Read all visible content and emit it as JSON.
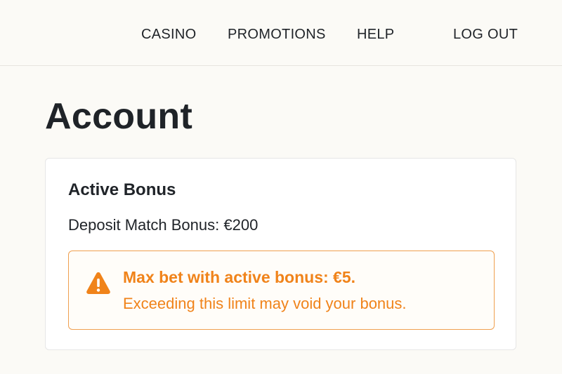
{
  "nav": {
    "casino": "CASINO",
    "promotions": "PROMOTIONS",
    "help": "HELP",
    "logout": "LOG OUT"
  },
  "page": {
    "title": "Account"
  },
  "bonus_card": {
    "title": "Active Bonus",
    "bonus_label": "Deposit Match Bonus:",
    "bonus_amount": "€200",
    "alert": {
      "icon": "warning-triangle-icon",
      "headline": "Max bet with active bonus: €5.",
      "message": "Exceeding this limit may void your bonus.",
      "color": "#f0831a"
    }
  }
}
